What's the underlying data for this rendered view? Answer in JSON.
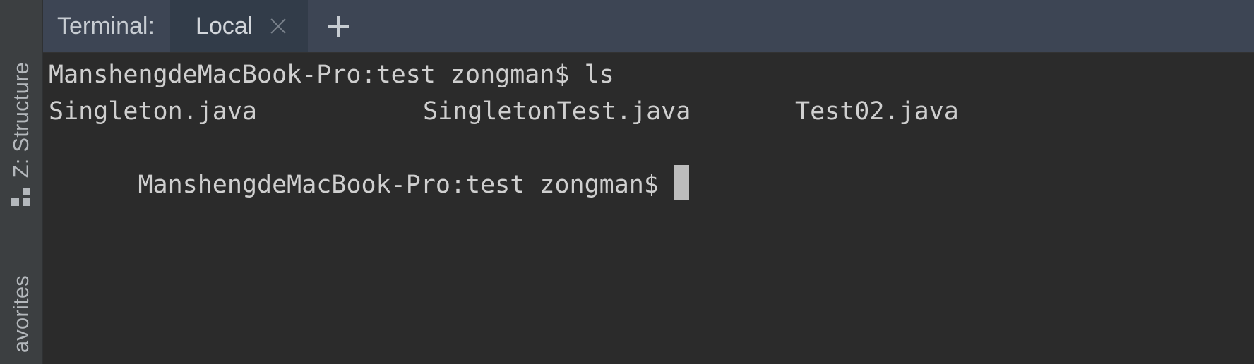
{
  "sidebar": {
    "structure_label": "Z: Structure",
    "structure_icon": "structure-icon",
    "favorites_label": "avorites"
  },
  "header": {
    "title": "Terminal:",
    "tabs": [
      {
        "label": "Local",
        "active": true,
        "close_icon": "close-icon"
      }
    ],
    "add_icon": "plus-icon"
  },
  "terminal": {
    "lines": [
      {
        "prompt": "ManshengdeMacBook-Pro:test zongman$",
        "command": "ls"
      }
    ],
    "ls_output": [
      "Singleton.java",
      "SingletonTest.java",
      "Test02.java"
    ],
    "current_prompt": "ManshengdeMacBook-Pro:test zongman$"
  },
  "colors": {
    "header_bg": "#3d4554",
    "active_tab_bg": "#323c49",
    "terminal_bg": "#2b2b2b",
    "terminal_text": "#cfcfcf",
    "cursor": "#bdbdbd"
  }
}
